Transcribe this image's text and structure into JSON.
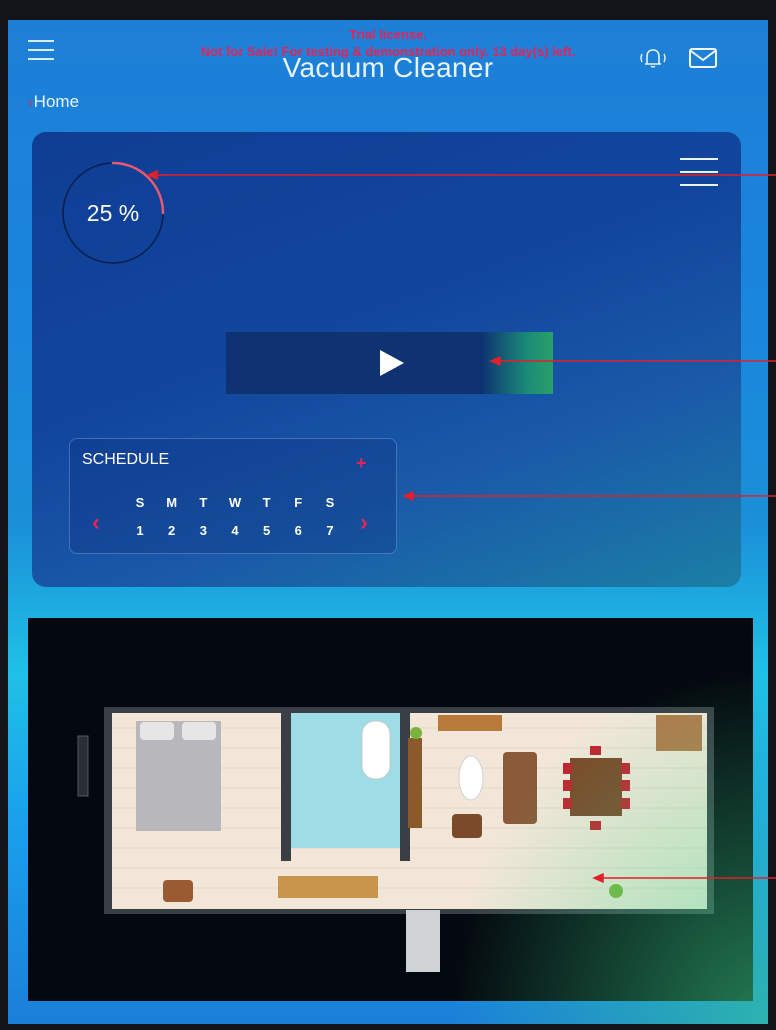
{
  "header": {
    "title": "Vacuum Cleaner",
    "trial_line1": "Trial license.",
    "trial_line2": "Not for Sale! For testing & demonstration only. 13 day(s) left.",
    "menu_icon": "hamburger-icon",
    "alarm_icon": "alarm-bell-icon",
    "mail_icon": "mail-icon"
  },
  "breadcrumb": {
    "arrow": "‹",
    "home": "Home"
  },
  "status": {
    "progress_label": "25 %",
    "progress_value": 0.25
  },
  "controls": {
    "play_icon": "play-icon",
    "panel_menu_icon": "hamburger-icon"
  },
  "schedule": {
    "title": "SCHEDULE",
    "add": "+",
    "prev": "‹",
    "next": "›",
    "days": [
      "S",
      "M",
      "T",
      "W",
      "T",
      "F",
      "S"
    ],
    "dates": [
      "1",
      "2",
      "3",
      "4",
      "5",
      "6",
      "7"
    ]
  },
  "colors": {
    "accent": "#e3245a",
    "panel": "#12479e",
    "background": "#1a84dd",
    "map_background": "#04090f",
    "annotation_arrow": "#e0202a"
  }
}
